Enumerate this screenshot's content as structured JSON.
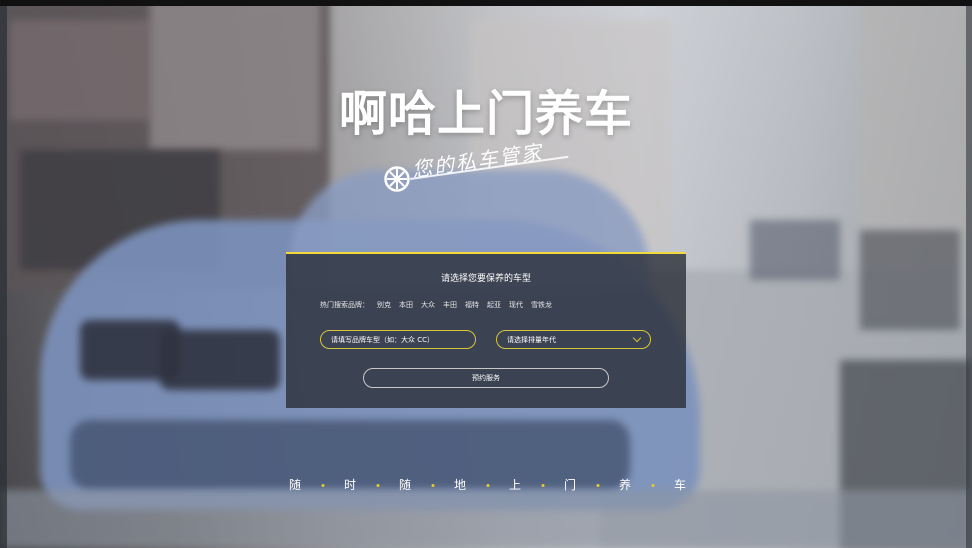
{
  "page": {
    "title": "啊哈上门养车",
    "slogan": "您的私车管家"
  },
  "form": {
    "heading": "请选择您要保养的车型",
    "hot_brands_label": "热门搜索品牌：",
    "hot_brands": [
      "别克",
      "本田",
      "大众",
      "丰田",
      "福特",
      "起亚",
      "现代",
      "雪铁龙"
    ],
    "model_field_placeholder": "请填写品牌车型（如：大众 CC）",
    "year_select_placeholder": "请选择排量年代",
    "submit_label": "预约服务"
  },
  "tagline": {
    "chars": [
      "随",
      "时",
      "随",
      "地",
      "上",
      "门",
      "养",
      "车"
    ]
  },
  "colors": {
    "accent": "#f1d83b",
    "panel_bg": "#2c3038"
  }
}
